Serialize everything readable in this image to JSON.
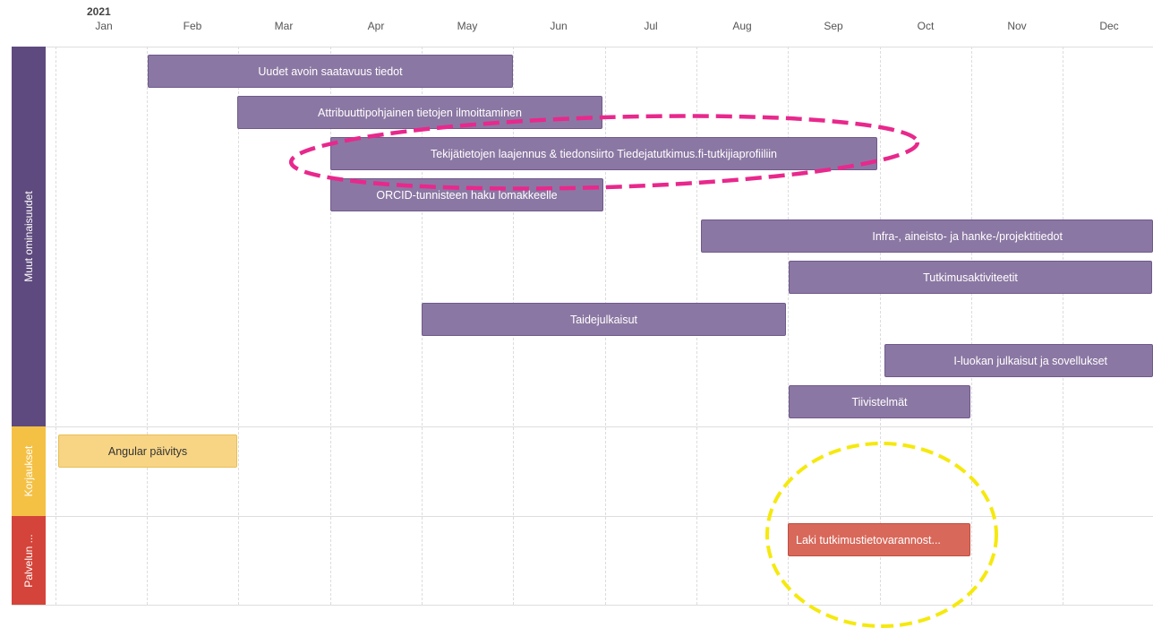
{
  "timeline": {
    "year": "2021",
    "months": [
      "Jan",
      "Feb",
      "Mar",
      "Apr",
      "May",
      "Jun",
      "Jul",
      "Aug",
      "Sep",
      "Oct",
      "Nov",
      "Dec"
    ]
  },
  "lanes": [
    {
      "label": "Muut ominaisuudet",
      "color": "#5e4a7e"
    },
    {
      "label": "Korjaukset",
      "color": "#f4c145"
    },
    {
      "label": "Palvelun ...",
      "color": "#d4443a"
    }
  ],
  "bars": [
    {
      "label": "Uudet avoin saatavuus tiedot",
      "style": "purple"
    },
    {
      "label": "Attribuuttipohjainen tietojen ilmoittaminen",
      "style": "purple"
    },
    {
      "label": "Tekijätietojen laajennus & tiedonsiirto Tiedejatutkimus.fi-tutkijiaprofiiliin",
      "style": "purple"
    },
    {
      "label": "ORCID-tunnisteen haku lomakkeelle",
      "style": "purple"
    },
    {
      "label": "Infra-, aineisto- ja hanke-/projektitiedot",
      "style": "purple"
    },
    {
      "label": "Tutkimusaktiviteetit",
      "style": "purple"
    },
    {
      "label": "Taidejulkaisut",
      "style": "purple"
    },
    {
      "label": "I-luokan julkaisut ja sovellukset",
      "style": "purple"
    },
    {
      "label": "Tiivistelmät",
      "style": "purple"
    },
    {
      "label": "Angular päivitys",
      "style": "yellow"
    },
    {
      "label": "Laki tutkimustietovarannost...",
      "style": "red"
    }
  ],
  "annotations": {
    "highlight_color": "#e8288c",
    "circle_color": "#f5e90e"
  }
}
